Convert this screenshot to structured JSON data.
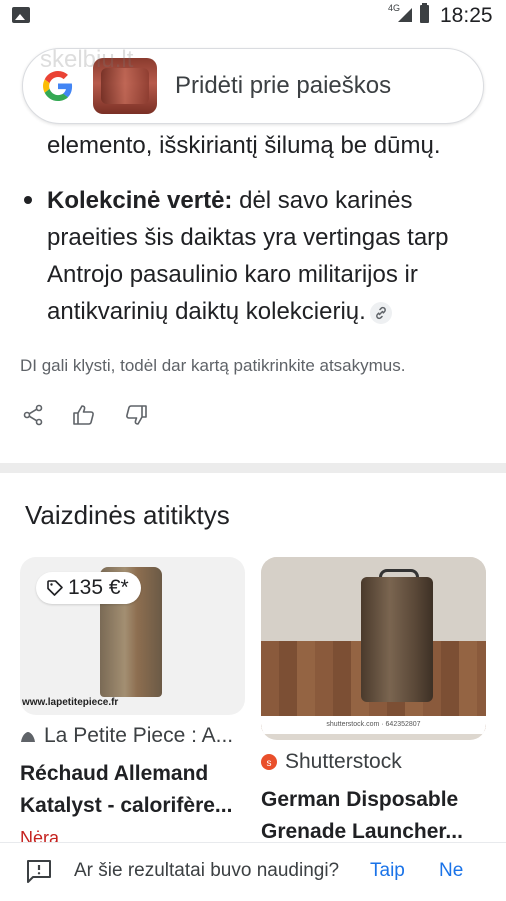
{
  "status_bar": {
    "network": "4G",
    "time": "18:25"
  },
  "search": {
    "label": "Pridėti prie paieškos",
    "watermark": "skelbiu.lt"
  },
  "answer": {
    "cut_line": "elemento, išskiriantį šilumą be dūmų.",
    "bullet_bold": "Kolekcinė vertė:",
    "bullet_text": " dėl savo karinės praeities šis daiktas yra vertingas tarp Antrojo pasaulinio karo militarijos ir antikvarinių daiktų kolekcierių.",
    "disclaimer": "DI gali klysti, todėl dar kartą patikrinkite atsakymus."
  },
  "visual_matches": {
    "title": "Vaizdinės atitiktys",
    "cards": [
      {
        "price": "135 €*",
        "image_watermark": "www.lapetitepiece.fr",
        "source": "La Petite Piece : A...",
        "title": "Réchaud Allemand Katalyst - calorifère...",
        "stock": "Nėra"
      },
      {
        "image_watermark": "shutterstock.com · 642352807",
        "source": "Shutterstock",
        "title": "German Disposable Grenade Launcher..."
      }
    ]
  },
  "feedback_bar": {
    "question": "Ar šie rezultatai buvo naudingi?",
    "yes": "Taip",
    "no": "Ne"
  }
}
